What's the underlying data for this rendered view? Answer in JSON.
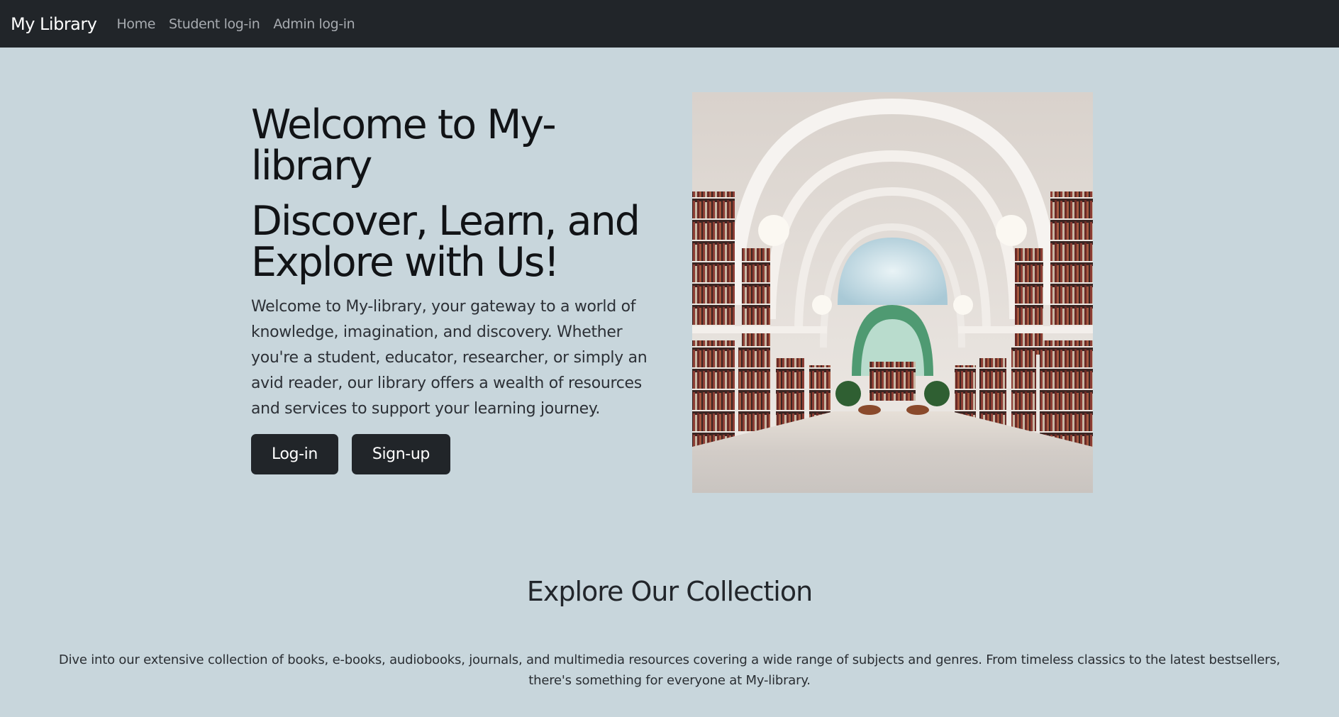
{
  "nav": {
    "brand": "My Library",
    "links": [
      "Home",
      "Student log-in",
      "Admin log-in"
    ]
  },
  "hero": {
    "title": "Welcome to My-library",
    "subtitle": "Discover, Learn, and Explore with Us!",
    "description": "Welcome to My-library, your gateway to a world of knowledge, imagination, and discovery. Whether you're a student, educator, researcher, or simply an avid reader, our library offers a wealth of resources and services to support your learning journey.",
    "login_label": "Log-in",
    "signup_label": "Sign-up"
  },
  "collection": {
    "heading": "Explore Our Collection",
    "text": "Dive into our extensive collection of books, e-books, audiobooks, journals, and multimedia resources covering a wide range of subjects and genres. From timeless classics to the latest bestsellers, there's something for everyone at My-library."
  },
  "colors": {
    "navbar": "#212529",
    "page_background": "#c8d6dc",
    "button": "#212529"
  }
}
